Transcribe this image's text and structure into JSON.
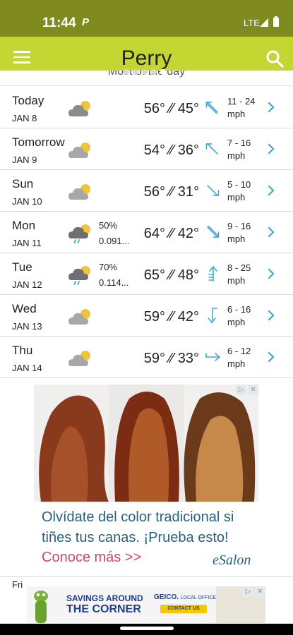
{
  "status_bar": {
    "time": "11:44",
    "app_glyph": "P",
    "network": "LTE"
  },
  "app_bar": {
    "title": "Perry",
    "menu_icon": "hamburger-menu-icon",
    "search_icon": "search-icon",
    "pages_count": 5,
    "active_page": 4
  },
  "subheader": {
    "text": "Most of the day"
  },
  "colors": {
    "status_bar": "#7f8a1f",
    "app_bar": "#c3d632",
    "accent_blue": "#41a9cf",
    "row_divider": "#d9d9d9"
  },
  "forecast": [
    {
      "day": "Today",
      "date": "JAN 8",
      "icon": "partly-cloudy-icon",
      "precip_pct": "",
      "precip_amt": "",
      "temp": "56° ⁄⁄ 45°",
      "wind_dir": "NW",
      "wind": "11 - 24",
      "wind_unit": "mph"
    },
    {
      "day": "Tomorrow",
      "date": "JAN 9",
      "icon": "partly-cloudy-icon",
      "precip_pct": "",
      "precip_amt": "",
      "temp": "54° ⁄⁄ 36°",
      "wind_dir": "NW",
      "wind": "7 - 16",
      "wind_unit": "mph"
    },
    {
      "day": "Sun",
      "date": "JAN 10",
      "icon": "partly-cloudy-icon",
      "precip_pct": "",
      "precip_amt": "",
      "temp": "56° ⁄⁄ 31°",
      "wind_dir": "NW",
      "wind": "5 - 10",
      "wind_unit": "mph"
    },
    {
      "day": "Mon",
      "date": "JAN 11",
      "icon": "rain-partly-cloudy-icon",
      "precip_pct": "50%",
      "precip_amt": "0.091...",
      "temp": "64° ⁄⁄ 42°",
      "wind_dir": "SE",
      "wind": "9 - 16",
      "wind_unit": "mph"
    },
    {
      "day": "Tue",
      "date": "JAN 12",
      "icon": "rain-partly-cloudy-icon",
      "precip_pct": "70%",
      "precip_amt": "0.114...",
      "temp": "65° ⁄⁄ 48°",
      "wind_dir": "S",
      "wind": "8 - 25",
      "wind_unit": "mph"
    },
    {
      "day": "Wed",
      "date": "JAN 13",
      "icon": "partly-cloudy-icon",
      "precip_pct": "",
      "precip_amt": "",
      "temp": "59° ⁄⁄ 42°",
      "wind_dir": "N",
      "wind": "6 - 16",
      "wind_unit": "mph"
    },
    {
      "day": "Thu",
      "date": "JAN 14",
      "icon": "partly-cloudy-icon",
      "precip_pct": "",
      "precip_amt": "",
      "temp": "59° ⁄⁄ 33°",
      "wind_dir": "W",
      "wind": "6 - 12",
      "wind_unit": "mph"
    }
  ],
  "ad": {
    "headline": "Olvídate del color tradicional si tiñes tus canas. ¡Prueba esto!",
    "cta": "Conoce más >>",
    "brand": "eSalon"
  },
  "next_day_fragment": "Fri",
  "banner_ad": {
    "line1": "SAVINGS AROUND",
    "line2": "THE CORNER",
    "brand": "GEICO.",
    "brand_sub": "LOCAL OFFICE",
    "contact": "CONTACT US"
  }
}
